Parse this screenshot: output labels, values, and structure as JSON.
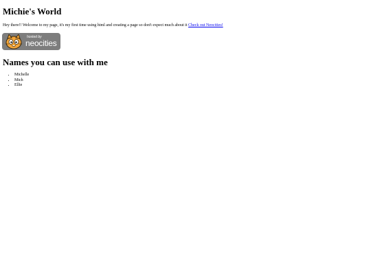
{
  "page": {
    "title": "Michie's World",
    "intro_text": "Hey there!! Welcome to my page, it's my first time using html and creating a page so don't expect much about it",
    "intro_link": "Check out Neocities!",
    "badge": {
      "small_text": "hosted by",
      "big_text": "neocities",
      "icon": "neocities-cat-icon"
    },
    "names_heading": "Names you can use with me",
    "names": [
      "Michelle",
      "Mich",
      "Ellie"
    ]
  },
  "colors": {
    "link": "#0000ee",
    "badge_bg": "#7d7d7d"
  }
}
